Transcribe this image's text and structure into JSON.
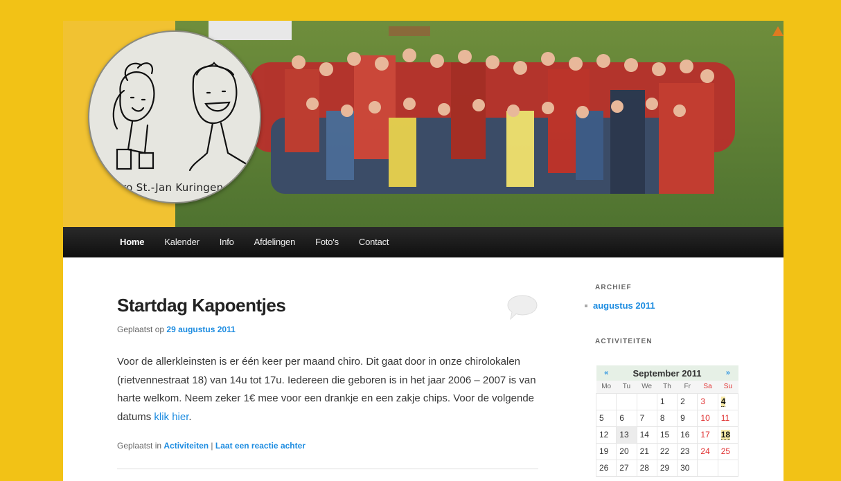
{
  "logo": {
    "text": "Chiro St.-Jan Kuringen Hei"
  },
  "nav": {
    "items": [
      {
        "label": "Home",
        "active": true
      },
      {
        "label": "Kalender",
        "active": false
      },
      {
        "label": "Info",
        "active": false
      },
      {
        "label": "Afdelingen",
        "active": false
      },
      {
        "label": "Foto's",
        "active": false
      },
      {
        "label": "Contact",
        "active": false
      }
    ]
  },
  "post": {
    "title": "Startdag Kapoentjes",
    "meta_prefix": "Geplaatst op",
    "date": "29 augustus 2011",
    "body": "Voor de allerkleinsten is er één keer per maand chiro. Dit gaat door in onze chirolokalen (rietvennestraat 18) van 14u tot 17u. Iedereen die geboren is in het jaar 2006 – 2007 is van harte welkom. Neem zeker 1€ mee voor een drankje en een zakje chips. Voor de volgende datums",
    "body_link": "klik hier",
    "body_end": ".",
    "footer_prefix": "Geplaatst in",
    "category": "Activiteiten",
    "separator": "|",
    "reply_link": "Laat een reactie achter"
  },
  "sidebar": {
    "archive_title": "ARCHIEF",
    "archive_items": [
      "augustus 2011"
    ],
    "activities_title": "ACTIVITEITEN",
    "calendar": {
      "prev": "«",
      "month": "September 2011",
      "next": "»",
      "days": [
        "Mo",
        "Tu",
        "We",
        "Th",
        "Fr",
        "Sa",
        "Su"
      ],
      "weeks": [
        [
          "",
          "",
          "",
          "1",
          "2",
          "3",
          "4"
        ],
        [
          "5",
          "6",
          "7",
          "8",
          "9",
          "10",
          "11"
        ],
        [
          "12",
          "13",
          "14",
          "15",
          "16",
          "17",
          "18"
        ],
        [
          "19",
          "20",
          "21",
          "22",
          "23",
          "24",
          "25"
        ],
        [
          "26",
          "27",
          "28",
          "29",
          "30",
          "",
          ""
        ]
      ]
    }
  },
  "colors": {
    "background": "#f2c216",
    "link": "#1b8be0",
    "nav_bg": "#1a1a1a",
    "weekend": "#e03030"
  }
}
